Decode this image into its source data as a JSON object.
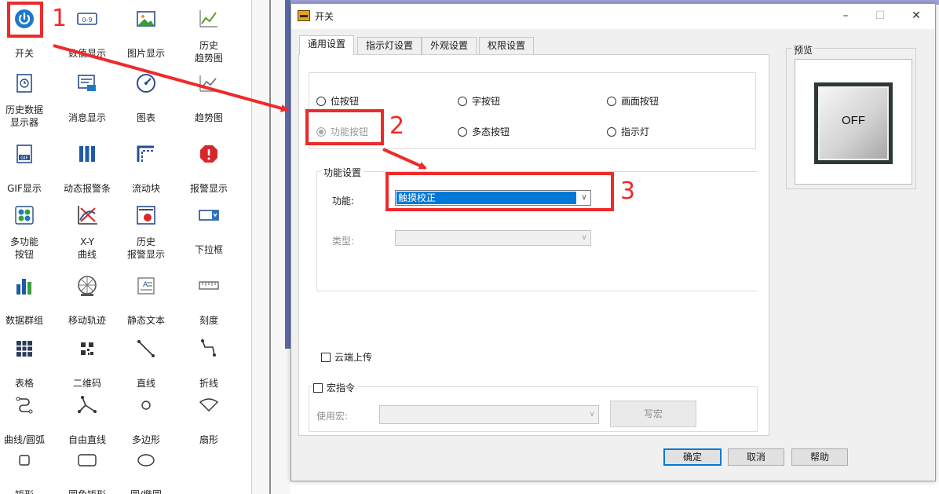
{
  "toolbox": {
    "items": [
      {
        "label": "开关",
        "icon": "power-icon"
      },
      {
        "label": "数值显示",
        "icon": "numeric-display-icon"
      },
      {
        "label": "图片显示",
        "icon": "image-icon"
      },
      {
        "label": "历史\n趋势图",
        "icon": "history-trend-icon"
      },
      {
        "label": "历史数据\n显示器",
        "icon": "history-data-icon"
      },
      {
        "label": "消息显示",
        "icon": "message-icon"
      },
      {
        "label": "图表",
        "icon": "gauge-icon"
      },
      {
        "label": "趋势图",
        "icon": "trend-icon"
      },
      {
        "label": "GIF显示",
        "icon": "gif-icon"
      },
      {
        "label": "动态报警条",
        "icon": "alarm-bar-icon"
      },
      {
        "label": "流动块",
        "icon": "flow-block-icon"
      },
      {
        "label": "报警显示",
        "icon": "alarm-icon"
      },
      {
        "label": "多功能\n按钮",
        "icon": "multi-button-icon"
      },
      {
        "label": "X-Y\n曲线",
        "icon": "xy-curve-icon"
      },
      {
        "label": "历史\n报警显示",
        "icon": "history-alarm-icon"
      },
      {
        "label": "下拉框",
        "icon": "dropdown-icon"
      },
      {
        "label": "数据群组",
        "icon": "bar-chart-icon"
      },
      {
        "label": "移动轨迹",
        "icon": "move-track-icon"
      },
      {
        "label": "静态文本",
        "icon": "static-text-icon"
      },
      {
        "label": "刻度",
        "icon": "scale-icon"
      },
      {
        "label": "表格",
        "icon": "table-icon"
      },
      {
        "label": "二维码",
        "icon": "qrcode-icon"
      },
      {
        "label": "直线",
        "icon": "line-icon"
      },
      {
        "label": "折线",
        "icon": "polyline-icon"
      },
      {
        "label": "曲线/圆弧",
        "icon": "curve-icon"
      },
      {
        "label": "自由直线",
        "icon": "free-line-icon"
      },
      {
        "label": "多边形",
        "icon": "polygon-icon"
      },
      {
        "label": "扇形",
        "icon": "sector-icon"
      },
      {
        "label": "矩形",
        "icon": "rectangle-icon"
      },
      {
        "label": "圆角矩形",
        "icon": "rounded-rect-icon"
      },
      {
        "label": "圆/椭圆",
        "icon": "ellipse-icon"
      }
    ]
  },
  "annotations": {
    "n1": "1",
    "n2": "2",
    "n3": "3",
    "color": "#ee2a2a"
  },
  "dialog": {
    "title": "开关",
    "tabs": [
      "通用设置",
      "指示灯设置",
      "外观设置",
      "权限设置"
    ],
    "button_types": {
      "bit": "位按钮",
      "word": "字按钮",
      "screen": "画面按钮",
      "function": "功能按钮",
      "multistate": "多态按钮",
      "indicator": "指示灯"
    },
    "function_group": {
      "title": "功能设置",
      "function_label": "功能:",
      "function_value": "触摸校正",
      "type_label": "类型:"
    },
    "cloud_upload": "云端上传",
    "macro": {
      "title": "宏指令",
      "use_label": "使用宏:",
      "write_button": "写宏"
    },
    "preview": {
      "title": "预览",
      "button_text": "OFF"
    },
    "buttons": {
      "ok": "确定",
      "cancel": "取消",
      "help": "帮助"
    }
  }
}
